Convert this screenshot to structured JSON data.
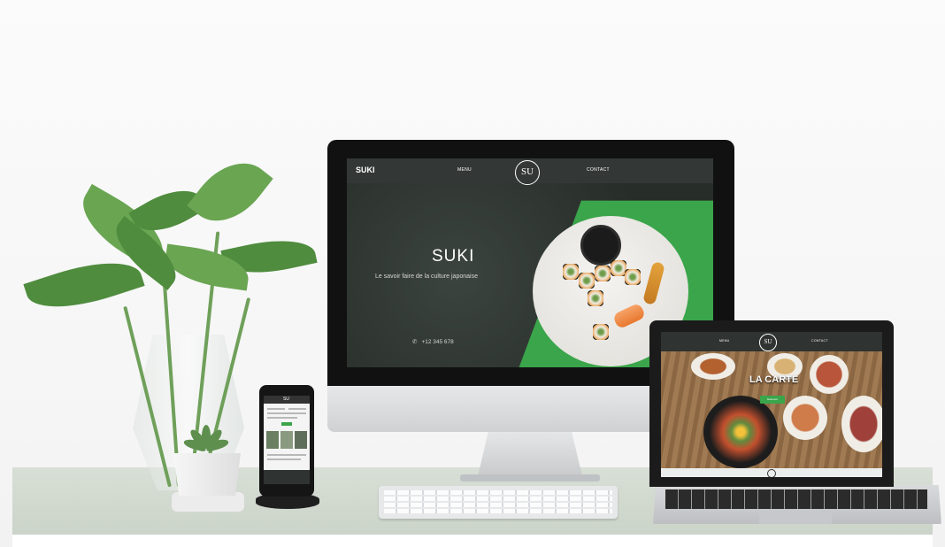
{
  "imac_site": {
    "brand": "SUKI",
    "nav": {
      "menu": "MENU",
      "contact": "CONTACT"
    },
    "logo_text": "SU",
    "hero_title": "SUKI",
    "hero_subtitle": "Le savoir faire de la culture japonaise",
    "phone": "+12 345 678",
    "phone_icon": "phone-icon",
    "accent_color": "#3aa54a"
  },
  "laptop_site": {
    "nav": {
      "menu": "MENU",
      "contact": "CONTACT"
    },
    "logo_text": "SU",
    "hero_title": "LA CARTE",
    "button_label": "Reserver"
  },
  "phone_site": {
    "logo_text": "SU"
  }
}
